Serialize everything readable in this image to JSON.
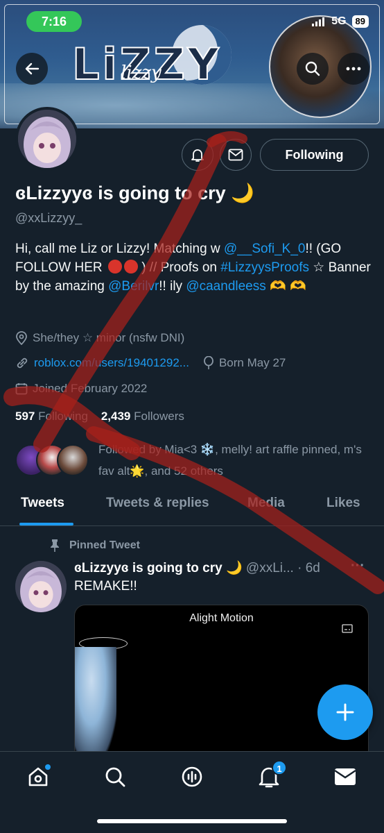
{
  "status_bar": {
    "time": "7:16",
    "network": "5G",
    "battery": "89"
  },
  "banner": {
    "logo_text": "LiZZY",
    "logo_script": "lizzy"
  },
  "profile": {
    "display_name": "ɞLizzyyɞ is going to cry 🌙",
    "handle": "@xxLizzyy_",
    "following_button": "Following",
    "bio": {
      "part1": "Hi, call me Liz or Lizzy! Matching w ",
      "mention1": "@__Sofi_K_0",
      "part2": "!! (GO FOLLOW HER ",
      "part3": ") // Proofs on ",
      "hashtag": "#LizzyysProofs",
      "part4": " ☆ Banner by the amazing ",
      "mention2": "@Berilvr",
      "part5": "!! ily ",
      "mention3": "@caandleess",
      "hands": "🫶 🫶"
    },
    "pronouns": "She/they ☆ minor (nsfw DNI)",
    "website": "roblox.com/users/19401292...",
    "birthday": "Born May 27",
    "joined": "Joined February 2022",
    "following_count": "597",
    "following_label": "Following",
    "followers_count": "2,439",
    "followers_label": "Followers",
    "followed_by": "Followed by Mia<3 ❄️, melly! art raffle pinned, m's fav alt🌟, and 52 others"
  },
  "tabs": [
    "Tweets",
    "Tweets & replies",
    "Media",
    "Likes"
  ],
  "tweet": {
    "pinned_label": "Pinned Tweet",
    "author_name": "ɞLizzyyɞ is going to cry 🌙",
    "author_handle": "@xxLi... · 6d",
    "more": "···",
    "text": "REMAKE!!",
    "media_title": "Alight Motion"
  },
  "nav": {
    "notification_badge": "1"
  },
  "colors": {
    "background": "#15202b",
    "accent": "#1d9bf0",
    "muted": "#8b98a5",
    "border": "#536471",
    "overlay_red": "#a8201a"
  }
}
